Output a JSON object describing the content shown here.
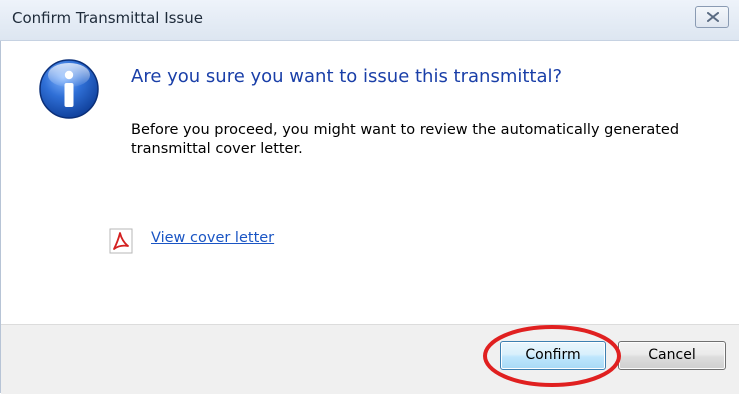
{
  "window": {
    "title": "Confirm Transmittal Issue",
    "close_icon": "close-icon"
  },
  "main": {
    "icon": "info-icon",
    "heading": "Are you sure you want to issue this transmittal?",
    "body": "Before you proceed, you might want to review the automatically generated transmittal cover letter.",
    "link_icon": "pdf-icon",
    "link_label": "View cover letter"
  },
  "buttons": {
    "confirm_label": "Confirm",
    "cancel_label": "Cancel"
  },
  "annotation": {
    "highlight_color": "#e02020",
    "highlight_target": "confirm-button"
  },
  "colors": {
    "heading": "#1a3fa8",
    "link": "#1a55c4",
    "footer_bg": "#f0f0f0"
  }
}
